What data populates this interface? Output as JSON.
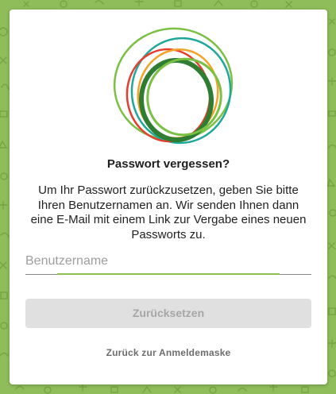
{
  "page": {
    "background_color": "#8fbd5a",
    "pattern_color": "#6f9c40"
  },
  "logo": {
    "icon": "circles-logo-icon",
    "colors": [
      "#1fa89a",
      "#7ac143",
      "#e53e2e",
      "#f4a329",
      "#2e7d32"
    ]
  },
  "forgot_password": {
    "title": "Passwort vergessen?",
    "description": "Um Ihr Passwort zurückzusetzen, geben Sie bitte Ihren Benutzernamen an. Wir senden Ihnen dann eine E-Mail mit einem Link zur Vergabe eines neuen Passworts zu.",
    "username_placeholder": "Benutzername",
    "username_value": "",
    "reset_button_label": "Zurücksetzen",
    "back_link_label": "Zurück zur Anmeldemaske"
  },
  "colors": {
    "accent": "#8cc152",
    "button_disabled_bg": "#e0e0e0",
    "button_disabled_text": "#a6a6a6"
  }
}
